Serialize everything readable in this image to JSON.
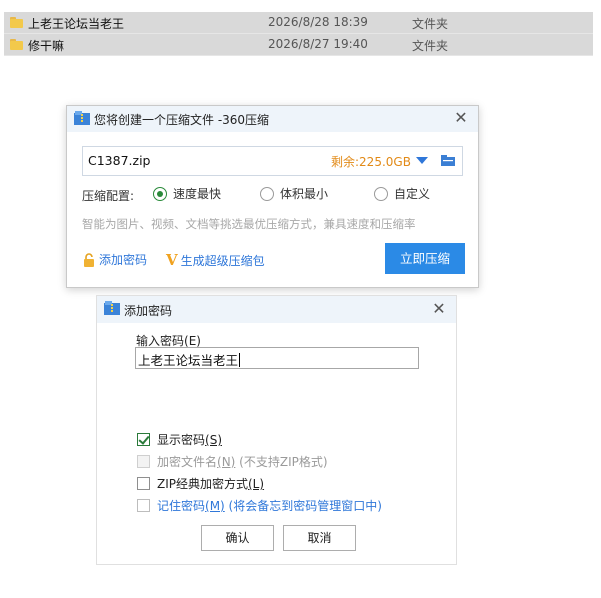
{
  "explorer": {
    "files": [
      {
        "name": "上老王论坛当老王",
        "date": "2026/8/28 18:39",
        "type": "文件夹"
      },
      {
        "name": "修干嘛",
        "date": "2026/8/27 19:40",
        "type": "文件夹"
      }
    ]
  },
  "compress_dialog": {
    "title": "您将创建一个压缩文件 -360压缩",
    "filename": "C1387.zip",
    "free_space": "剩余:225.0GB",
    "config_label": "压缩配置:",
    "options": [
      {
        "label": "速度最快",
        "checked": true
      },
      {
        "label": "体积最小",
        "checked": false
      },
      {
        "label": "自定义",
        "checked": false
      }
    ],
    "hint": "智能为图片、视频、文档等挑选最优压缩方式，兼具速度和压缩率",
    "add_password_link": "添加密码",
    "super_compress_link": "生成超级压缩包",
    "compress_button": "立即压缩",
    "accent_color": "#2b8ae6"
  },
  "password_dialog": {
    "title": "添加密码",
    "input_label": "输入密码",
    "input_label_key": "(E)",
    "password_value": "上老王论坛当老王",
    "checkboxes": [
      {
        "label": "显示密码",
        "key": "(S)",
        "extra": "",
        "checked": true,
        "disabled": false
      },
      {
        "label": "加密文件名",
        "key": "(N)",
        "extra": " (不支持ZIP格式)",
        "checked": false,
        "disabled": true
      },
      {
        "label": "ZIP经典加密方式",
        "key": "(L)",
        "extra": "",
        "checked": false,
        "disabled": false
      },
      {
        "label": "记住密码",
        "key": "(M)",
        "extra": " (将会备忘到密码管理窗口中)",
        "checked": false,
        "disabled": false
      }
    ],
    "ok_button": "确认",
    "cancel_button": "取消"
  }
}
